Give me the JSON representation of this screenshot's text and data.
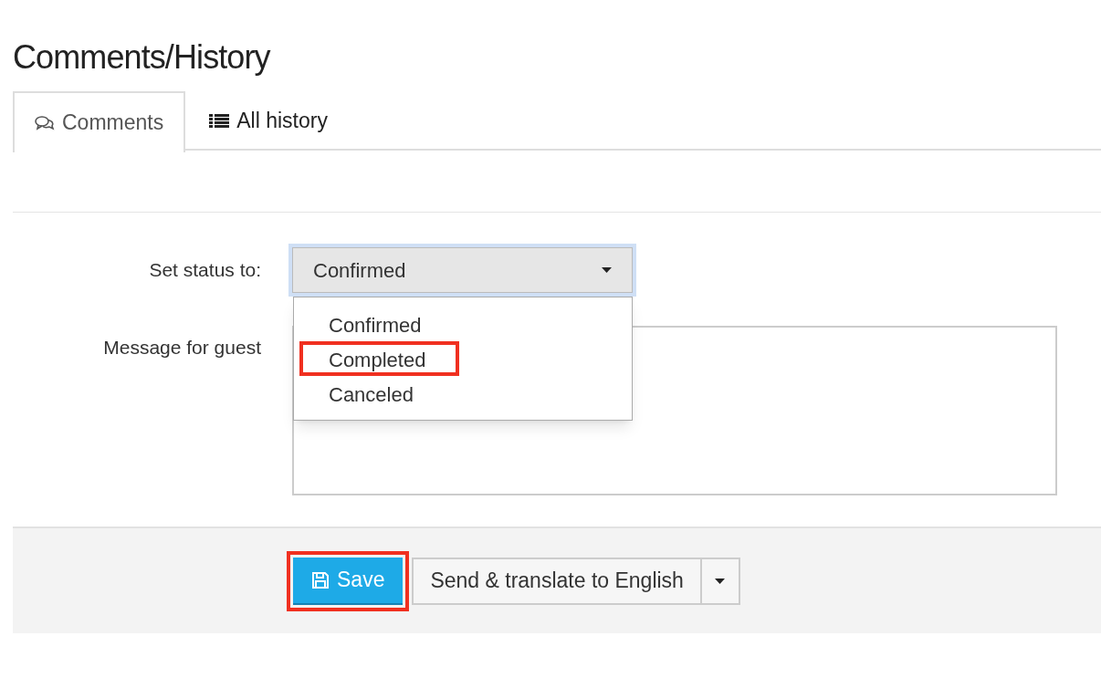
{
  "heading": "Comments/History",
  "tabs": [
    {
      "label": "Comments",
      "kind": "comments",
      "selected": true
    },
    {
      "label": "All history",
      "kind": "list",
      "selected": false
    }
  ],
  "status": {
    "label": "Set status to:",
    "value": "Confirmed",
    "expanded": true,
    "options": [
      {
        "label": "Confirmed",
        "highlighted": false
      },
      {
        "label": "Completed",
        "highlighted": true
      },
      {
        "label": "Canceled",
        "highlighted": false
      }
    ]
  },
  "message": {
    "label": "Message for guest"
  },
  "actions": {
    "save": {
      "label": "Save",
      "highlighted": true
    },
    "send": {
      "label": "Send & translate to English"
    }
  }
}
